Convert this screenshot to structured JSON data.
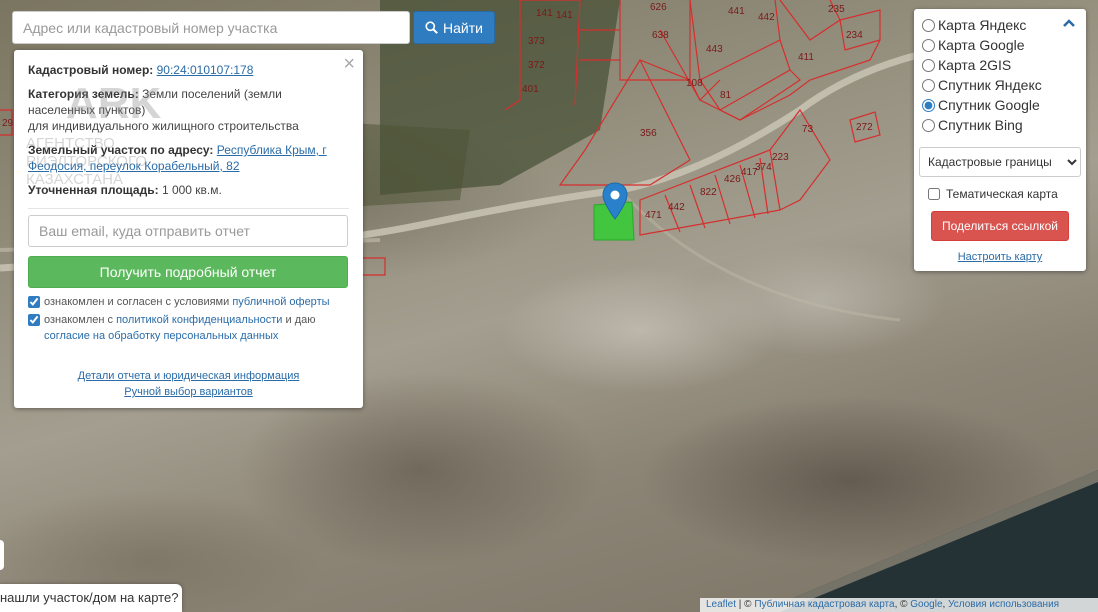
{
  "search": {
    "placeholder": "Адрес или кадастровый номер участка",
    "button_label": "Найти"
  },
  "info": {
    "cadastral_label": "Кадастровый номер:",
    "cadastral_value": "90:24:010107:178",
    "category_label": "Категория земель:",
    "category_value": "Земли поселений (земли населенных пунктов)",
    "use_value": "для индивидуального жилищного строительства",
    "address_label": "Земельный участок по адресу:",
    "address_value": "Республика Крым, г Феодосия, переулок Корабельный, 82",
    "area_label": "Уточненная площадь:",
    "area_value": "1 000 кв.м.",
    "watermark_text": "АГЕНТСТВО РИЭЛТОРСКОГО КАЗАХСТАНА",
    "email_placeholder": "Ваш email, куда отправить отчет",
    "report_button": "Получить подробный отчет",
    "consent1_text": "ознакомлен и согласен с условиями",
    "consent1_link": "публичной оферты",
    "consent2_text": "ознакомлен с",
    "consent2_link": "политикой конфиденциальности",
    "consent2_mid": "и даю",
    "consent2_link2": "согласие на обработку персональных данных",
    "details_link": "Детали отчета и юридическая информация",
    "manual_link": "Ручной выбор вариантов"
  },
  "layers": {
    "options": [
      {
        "label": "Карта Яндекс",
        "checked": false
      },
      {
        "label": "Карта Google",
        "checked": false
      },
      {
        "label": "Карта 2GIS",
        "checked": false
      },
      {
        "label": "Спутник Яндекс",
        "checked": false
      },
      {
        "label": "Спутник Google",
        "checked": true
      },
      {
        "label": "Спутник Bing",
        "checked": false
      }
    ],
    "overlay_selected": "Кадастровые границы",
    "thematic_label": "Тематическая карта",
    "share_button": "Поделиться ссылкой",
    "configure_link": "Настроить карту"
  },
  "map": {
    "parcel_numbers": [
      "626",
      "441",
      "442",
      "235",
      "638",
      "411",
      "234",
      "372",
      "373",
      "141",
      "141",
      "401",
      "108",
      "443",
      "81",
      "356",
      "73",
      "272",
      "223",
      "374",
      "417",
      "426",
      "822",
      "471",
      "442",
      "29"
    ],
    "colors": {
      "boundary": "#d62e2e",
      "selected_parcel": "#33cc33",
      "marker": "#2a81cb"
    }
  },
  "feedback_text": "нашли участок/дом на карте?",
  "attribution": {
    "leaflet": "Leaflet",
    "cadastral": "Публичная кадастровая карта",
    "google": "Google",
    "terms": "Условия использования"
  }
}
